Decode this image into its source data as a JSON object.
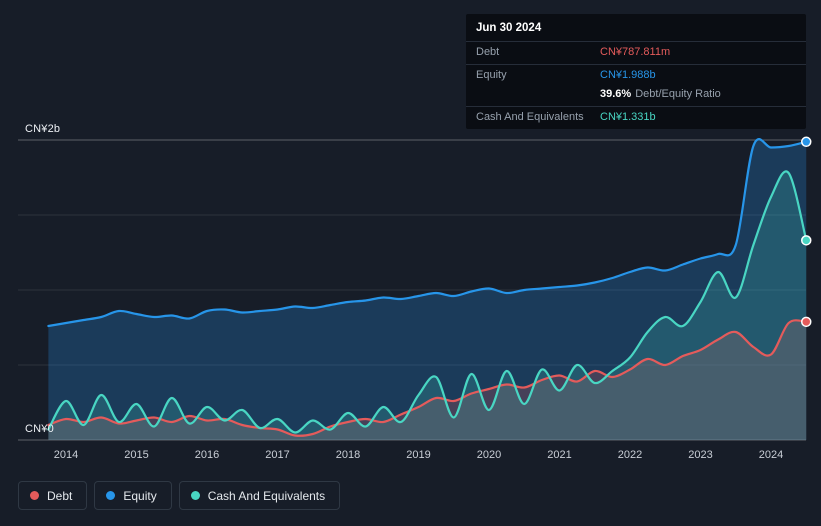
{
  "colors": {
    "background": "#171d28",
    "tooltip_bg": "#0a0d13",
    "debt": "#e45b5b",
    "equity": "#2795e9",
    "cash": "#49d6c3",
    "grid_major": "rgba(255,255,255,0.30)",
    "grid_minor": "rgba(255,255,255,0.10)"
  },
  "tooltip": {
    "date": "Jun 30 2024",
    "rows": {
      "debt": {
        "label": "Debt",
        "value": "CN¥787.811m"
      },
      "equity": {
        "label": "Equity",
        "value": "CN¥1.988b"
      },
      "ratio": {
        "value": "39.6%",
        "suffix": "Debt/Equity Ratio"
      },
      "cash": {
        "label": "Cash And Equivalents",
        "value": "CN¥1.331b"
      }
    }
  },
  "legend": {
    "items": [
      {
        "label": "Debt",
        "color": "#e45b5b"
      },
      {
        "label": "Equity",
        "color": "#2795e9"
      },
      {
        "label": "Cash And Equivalents",
        "color": "#49d6c3"
      }
    ]
  },
  "chart_data": {
    "type": "area",
    "y_axis_labels": {
      "top": "CN¥2b",
      "bottom": "CN¥0"
    },
    "ylim": [
      0,
      2.1
    ],
    "y_gridlines": [
      0,
      0.5,
      1.0,
      1.5,
      2.0
    ],
    "x_ticks": [
      "2014",
      "2015",
      "2016",
      "2017",
      "2018",
      "2019",
      "2020",
      "2021",
      "2022",
      "2023",
      "2024"
    ],
    "legend_position": "bottom-left",
    "x": [
      2013.75,
      2014.0,
      2014.25,
      2014.5,
      2014.75,
      2015.0,
      2015.25,
      2015.5,
      2015.75,
      2016.0,
      2016.25,
      2016.5,
      2016.75,
      2017.0,
      2017.25,
      2017.5,
      2017.75,
      2018.0,
      2018.25,
      2018.5,
      2018.75,
      2019.0,
      2019.25,
      2019.5,
      2019.75,
      2020.0,
      2020.25,
      2020.5,
      2020.75,
      2021.0,
      2021.25,
      2021.5,
      2021.75,
      2022.0,
      2022.25,
      2022.5,
      2022.75,
      2023.0,
      2023.25,
      2023.5,
      2023.75,
      2024.0,
      2024.25,
      2024.5
    ],
    "series": [
      {
        "name": "Equity",
        "unit": "CN¥b",
        "color": "#2795e9",
        "fill": "rgba(35,130,210,0.30)",
        "values": [
          0.76,
          0.78,
          0.8,
          0.82,
          0.86,
          0.84,
          0.82,
          0.83,
          0.81,
          0.86,
          0.87,
          0.85,
          0.86,
          0.87,
          0.89,
          0.88,
          0.9,
          0.92,
          0.93,
          0.95,
          0.94,
          0.96,
          0.98,
          0.96,
          0.99,
          1.01,
          0.98,
          1.0,
          1.01,
          1.02,
          1.03,
          1.05,
          1.08,
          1.12,
          1.15,
          1.13,
          1.17,
          1.21,
          1.24,
          1.3,
          1.96,
          1.95,
          1.96,
          1.988
        ]
      },
      {
        "name": "Debt",
        "unit": "CN¥b",
        "color": "#e45b5b",
        "fill": "rgba(225,85,85,0.22)",
        "values": [
          0.1,
          0.14,
          0.12,
          0.15,
          0.11,
          0.13,
          0.15,
          0.12,
          0.16,
          0.13,
          0.14,
          0.1,
          0.08,
          0.07,
          0.03,
          0.04,
          0.09,
          0.12,
          0.14,
          0.12,
          0.17,
          0.22,
          0.28,
          0.26,
          0.31,
          0.34,
          0.37,
          0.35,
          0.4,
          0.43,
          0.39,
          0.46,
          0.42,
          0.47,
          0.54,
          0.5,
          0.56,
          0.6,
          0.67,
          0.72,
          0.62,
          0.57,
          0.78,
          0.7878
        ]
      },
      {
        "name": "Cash And Equivalents",
        "unit": "CN¥b",
        "color": "#49d6c3",
        "fill": "rgba(70,210,190,0.20)",
        "values": [
          0.07,
          0.26,
          0.1,
          0.3,
          0.12,
          0.24,
          0.09,
          0.28,
          0.11,
          0.22,
          0.13,
          0.2,
          0.08,
          0.14,
          0.05,
          0.13,
          0.07,
          0.18,
          0.09,
          0.22,
          0.12,
          0.3,
          0.42,
          0.15,
          0.44,
          0.2,
          0.46,
          0.24,
          0.47,
          0.33,
          0.5,
          0.38,
          0.46,
          0.55,
          0.72,
          0.82,
          0.76,
          0.92,
          1.12,
          0.95,
          1.3,
          1.62,
          1.78,
          1.331
        ]
      }
    ]
  }
}
